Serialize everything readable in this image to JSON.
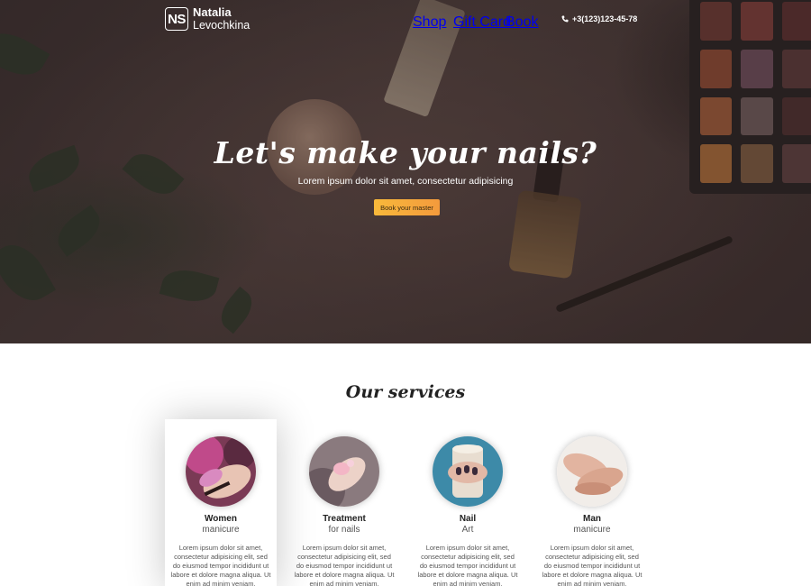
{
  "brand": {
    "logo_initials": "NS",
    "first_name": "Natalia",
    "last_name": "Levochkina"
  },
  "nav": {
    "items": [
      {
        "label": "Shop"
      },
      {
        "label": "Gift Card"
      },
      {
        "label": "Book"
      }
    ],
    "phone": "+3(123)123-45-78",
    "phone_icon": "phone-icon"
  },
  "hero": {
    "title": "Let's make your nails?",
    "subtitle": "Lorem ipsum dolor sit amet, consectetur adipisicing",
    "cta_label": "Book your master"
  },
  "services": {
    "title": "Our services",
    "items": [
      {
        "name": "Women",
        "sub": "manicure",
        "desc": "Lorem ipsum dolor sit amet, consectetur adipisicing elit, sed do eiusmod tempor incididunt ut labore et dolore magna aliqua. Ut enim ad minim veniam."
      },
      {
        "name": "Treatment",
        "sub": "for nails",
        "desc": "Lorem ipsum dolor sit amet, consectetur adipisicing elit, sed do eiusmod tempor incididunt ut labore et dolore magna aliqua. Ut enim ad minim veniam."
      },
      {
        "name": "Nail",
        "sub": "Art",
        "desc": "Lorem ipsum dolor sit amet, consectetur adipisicing elit, sed do eiusmod tempor incididunt ut labore et dolore magna aliqua. Ut enim ad minim veniam."
      },
      {
        "name": "Man",
        "sub": "manicure",
        "desc": "Lorem ipsum dolor sit amet, consectetur adipisicing elit, sed do eiusmod tempor incididunt ut labore et dolore magna aliqua. Ut enim ad minim veniam."
      }
    ]
  },
  "colors": {
    "accent_start": "#f8b93b",
    "accent_end": "#f39a3c"
  }
}
